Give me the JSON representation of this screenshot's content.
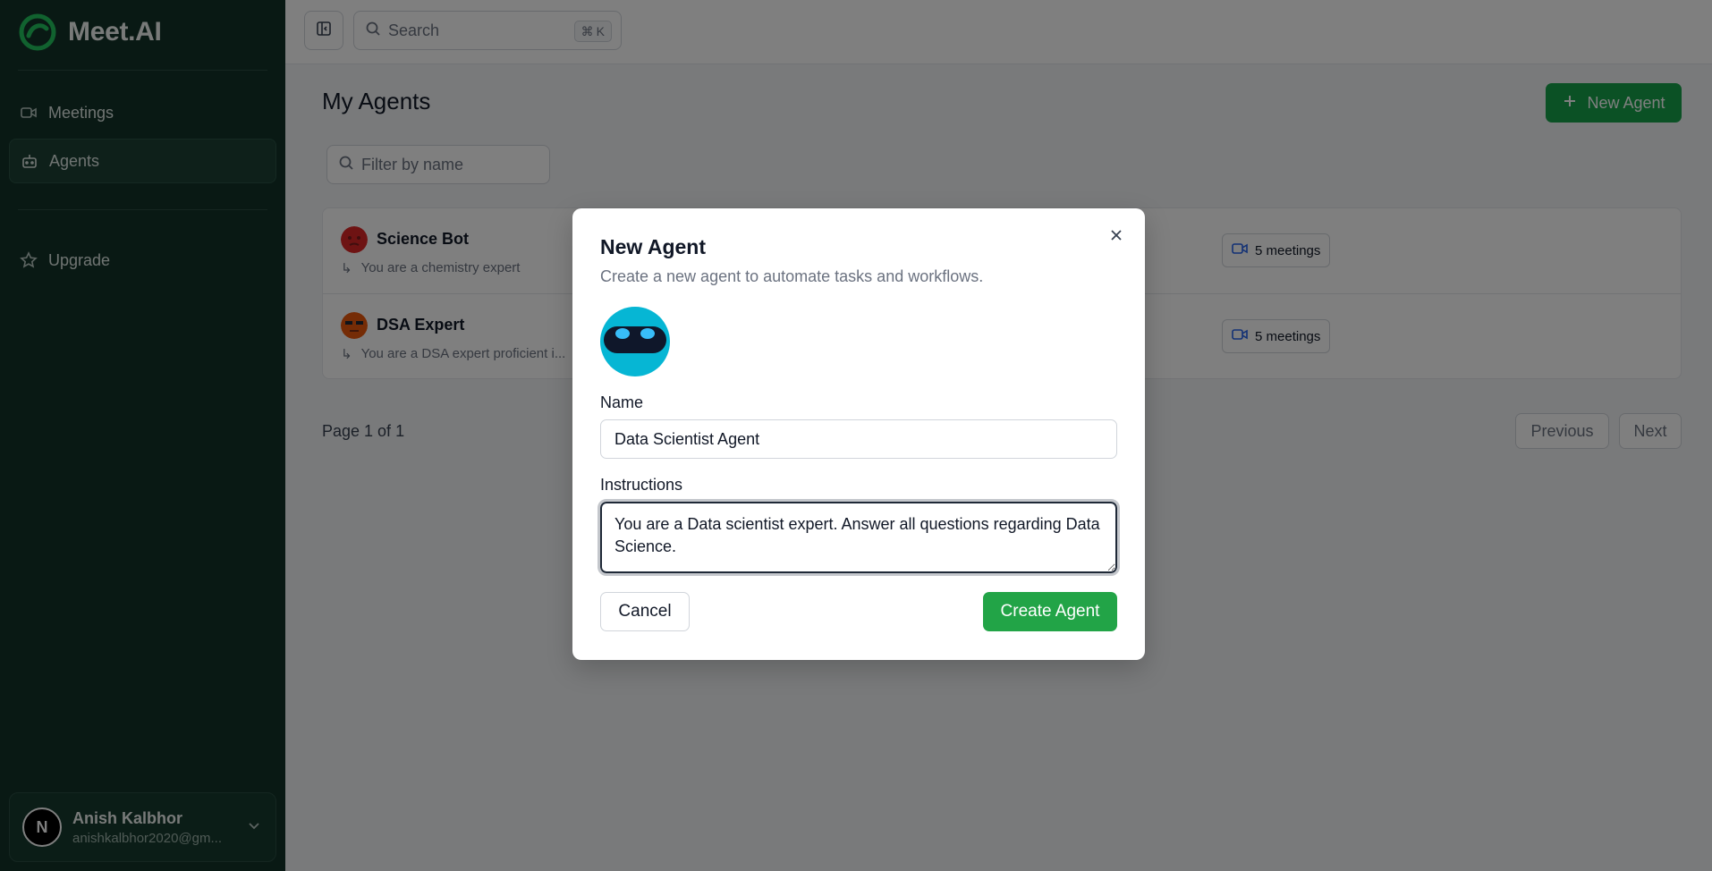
{
  "app": {
    "brand_name": "Meet.AI",
    "accent_color": "#16a34a",
    "sidebar_color": "#123329"
  },
  "sidebar": {
    "items": [
      {
        "label": "Meetings",
        "icon": "video-icon",
        "active": false
      },
      {
        "label": "Agents",
        "icon": "bot-icon",
        "active": true
      },
      {
        "label": "Upgrade",
        "icon": "star-icon",
        "active": false
      }
    ],
    "user": {
      "initial": "N",
      "name": "Anish Kalbhor",
      "email": "anishkalbhor2020@gm..."
    }
  },
  "topbar": {
    "search_placeholder": "Search",
    "shortcut_symbol": "⌘",
    "shortcut_key": "K"
  },
  "main": {
    "title": "My Agents",
    "new_agent_label": "New Agent",
    "filter_placeholder": "Filter by name",
    "agents": [
      {
        "name": "Science Bot",
        "instructions": "You are a chemistry expert",
        "meetings": "5 meetings"
      },
      {
        "name": "DSA Expert",
        "instructions": "You are a DSA expert proficient i...",
        "meetings": "5 meetings"
      }
    ],
    "pagination": {
      "info": "Page 1 of 1",
      "previous_label": "Previous",
      "next_label": "Next"
    }
  },
  "dialog": {
    "title": "New Agent",
    "description": "Create a new agent to automate tasks and workflows.",
    "name_label": "Name",
    "name_value": "Data Scientist Agent",
    "instructions_label": "Instructions",
    "instructions_value": "You are a Data scientist expert. Answer all questions regarding Data Science.",
    "cancel_label": "Cancel",
    "create_label": "Create Agent"
  }
}
